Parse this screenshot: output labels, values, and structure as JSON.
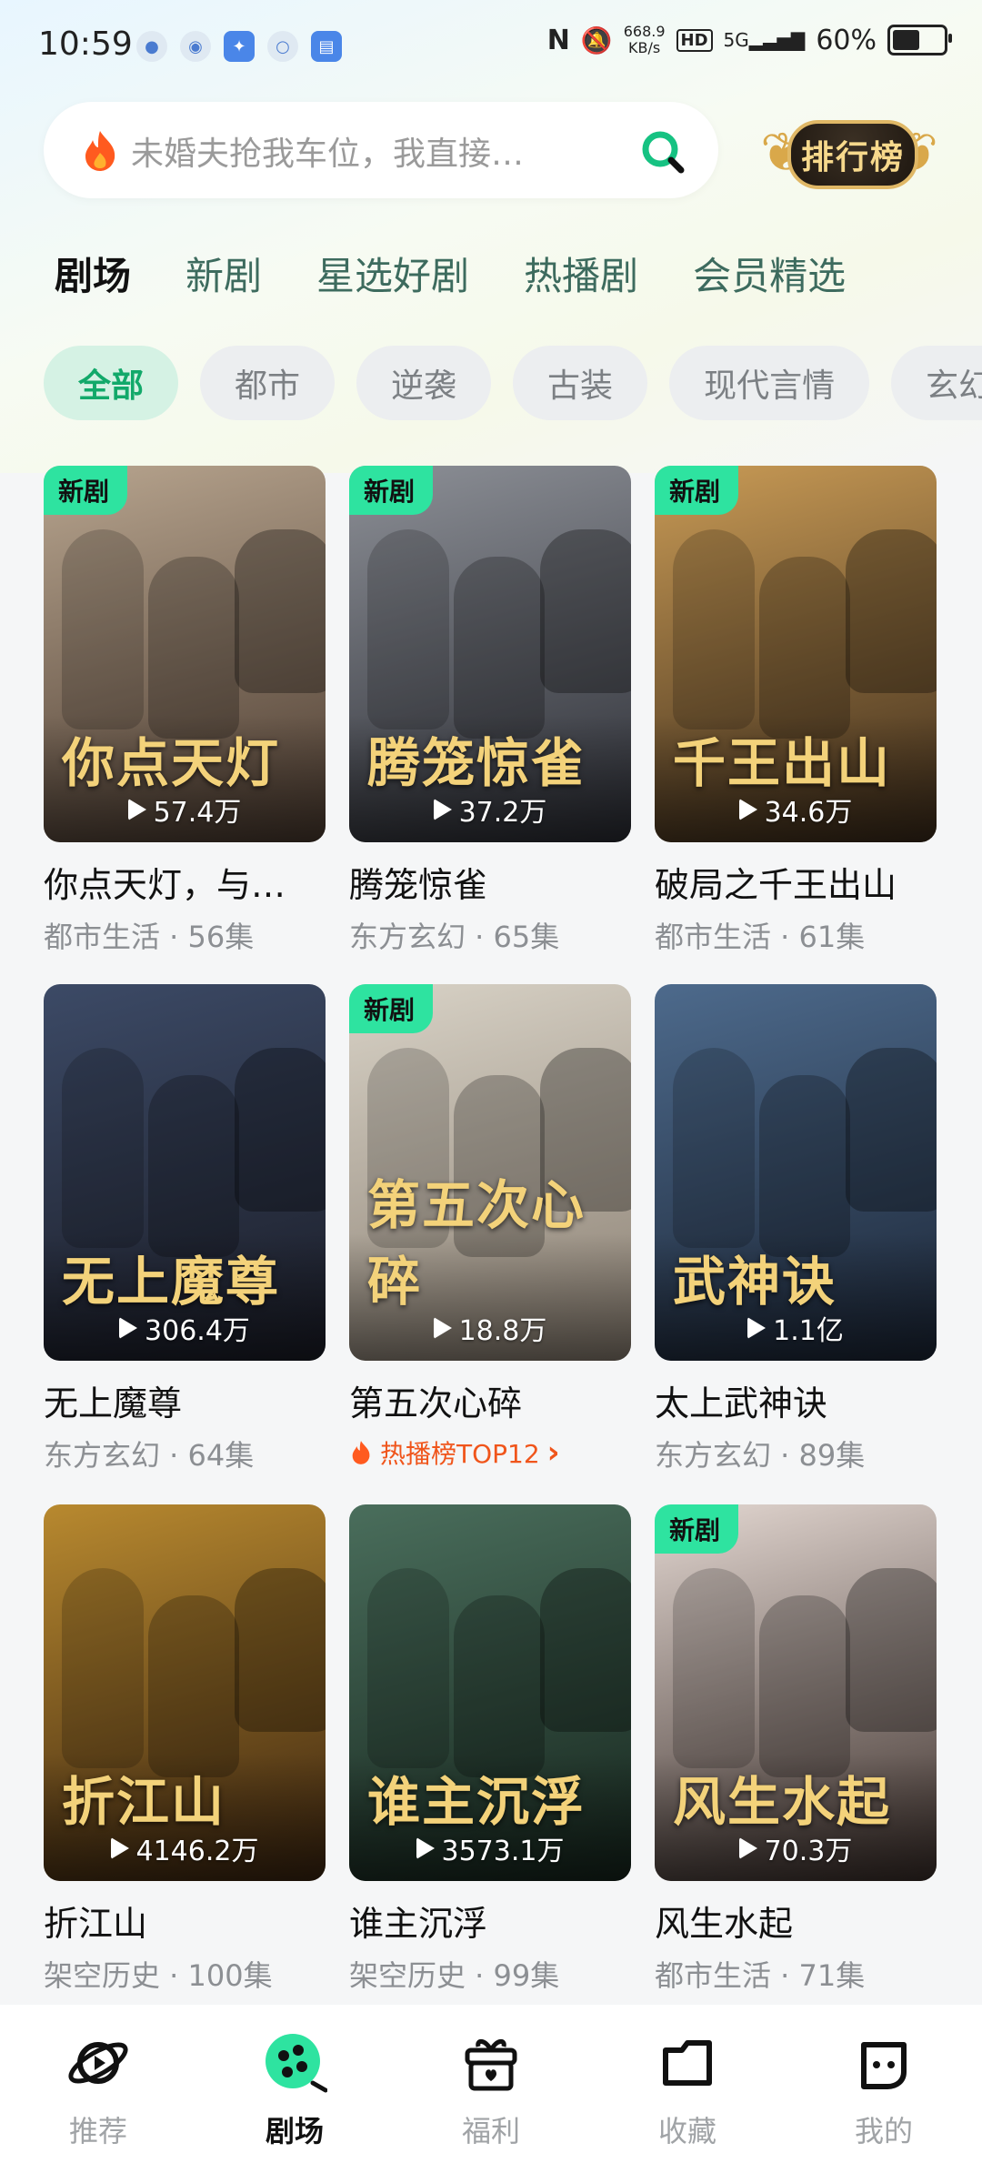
{
  "status_bar": {
    "time": "10:59",
    "net_speed_value": "668.9",
    "net_speed_unit": "KB/s",
    "hd": "HD",
    "signal": "5G",
    "battery_text": "60%",
    "battery_level": 0.6
  },
  "search": {
    "placeholder": "未婚夫抢我车位，我直接…"
  },
  "rank_button": {
    "label": "排行榜"
  },
  "tabs": [
    {
      "label": "剧场"
    },
    {
      "label": "新剧"
    },
    {
      "label": "星选好剧"
    },
    {
      "label": "热播剧"
    },
    {
      "label": "会员精选"
    }
  ],
  "chips": [
    {
      "label": "全部"
    },
    {
      "label": "都市"
    },
    {
      "label": "逆袭"
    },
    {
      "label": "古装"
    },
    {
      "label": "现代言情"
    },
    {
      "label": "玄幻"
    }
  ],
  "cards": [
    {
      "title": "你点天灯，与…",
      "meta": "都市生活 · 56集",
      "plays": "57.4万",
      "new": "新剧",
      "art": "你点天灯",
      "colors": [
        "#b7a48e",
        "#4a3a2f"
      ]
    },
    {
      "title": "腾笼惊雀",
      "meta": "东方玄幻 · 65集",
      "plays": "37.2万",
      "new": "新剧",
      "art": "腾笼惊雀",
      "colors": [
        "#8c8f96",
        "#2a2c33"
      ]
    },
    {
      "title": "破局之千王出山",
      "meta": "都市生活 · 61集",
      "plays": "34.6万",
      "new": "新剧",
      "art": "千王出山",
      "colors": [
        "#c89a55",
        "#3a2a1a"
      ]
    },
    {
      "title": "无上魔尊",
      "meta": "东方玄幻 · 64集",
      "plays": "306.4万",
      "new": "",
      "art": "无上魔尊",
      "colors": [
        "#3c4a66",
        "#1a1c26"
      ]
    },
    {
      "title": "第五次心碎",
      "meta": "",
      "rank": "热播榜TOP12",
      "plays": "18.8万",
      "new": "新剧",
      "art": "第五次心碎",
      "colors": [
        "#d8d2c6",
        "#8a7f72"
      ]
    },
    {
      "title": "太上武神诀",
      "meta": "东方玄幻 · 89集",
      "plays": "1.1亿",
      "new": "",
      "art": "武神诀",
      "colors": [
        "#4d6a8c",
        "#1b2535"
      ]
    },
    {
      "title": "折江山",
      "meta": "架空历史 · 100集",
      "plays": "4146.2万",
      "new": "",
      "art": "折江山",
      "colors": [
        "#b8892f",
        "#3a2410"
      ]
    },
    {
      "title": "谁主沉浮",
      "meta": "架空历史 · 99集",
      "plays": "3573.1万",
      "new": "",
      "art": "谁主沉浮",
      "colors": [
        "#4a6e5c",
        "#15241c"
      ]
    },
    {
      "title": "风生水起",
      "meta": "都市生活 · 71集",
      "plays": "70.3万",
      "new": "新剧",
      "art": "风生水起",
      "colors": [
        "#e2d6d0",
        "#3a2e2a"
      ]
    }
  ],
  "bottom_nav": [
    {
      "label": "推荐",
      "icon": "planet-icon"
    },
    {
      "label": "剧场",
      "icon": "theater-icon"
    },
    {
      "label": "福利",
      "icon": "gift-icon"
    },
    {
      "label": "收藏",
      "icon": "folder-icon"
    },
    {
      "label": "我的",
      "icon": "profile-icon"
    }
  ],
  "colors": {
    "accent": "#12a96a",
    "new_tag": "#2ee3a0",
    "rank_orange": "#f0551b"
  }
}
